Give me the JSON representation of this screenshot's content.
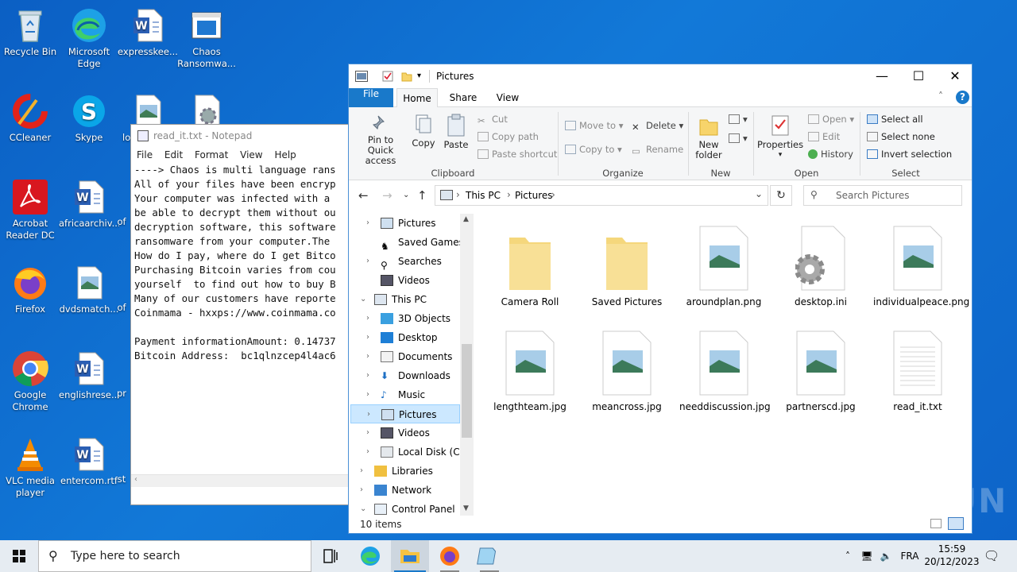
{
  "desktop": {
    "icons": [
      {
        "label": "Recycle Bin"
      },
      {
        "label": "Microsoft Edge"
      },
      {
        "label": "expresskee..."
      },
      {
        "label": "Chaos Ransomwa..."
      },
      {
        "label": "CCleaner"
      },
      {
        "label": "Skype"
      },
      {
        "label": "lo"
      },
      {
        "label": "Acrobat Reader DC"
      },
      {
        "label": "africaarchiv..."
      },
      {
        "label": "of"
      },
      {
        "label": "Firefox"
      },
      {
        "label": "dvdsmatch..."
      },
      {
        "label": "of"
      },
      {
        "label": "Google Chrome"
      },
      {
        "label": "englishrese..."
      },
      {
        "label": "pr"
      },
      {
        "label": "VLC media player"
      },
      {
        "label": "entercom.rtf"
      },
      {
        "label": "st"
      }
    ]
  },
  "notepad": {
    "title": "read_it.txt - Notepad",
    "menu": [
      "File",
      "Edit",
      "Format",
      "View",
      "Help"
    ],
    "text": "----> Chaos is multi language rans\nAll of your files have been encryp\nYour computer was infected with a \nbe able to decrypt them without ou\ndecryption software, this software\nransomware from your computer.The \nHow do I pay, where do I get Bitco\nPurchasing Bitcoin varies from cou\nyourself  to find out how to buy B\nMany of our customers have reporte\nCoinmama - hxxps://www.coinmama.co\n\nPayment informationAmount: 0.14737\nBitcoin Address:  bc1qlnzcep4l4ac6"
  },
  "explorer": {
    "title": "Pictures",
    "tabs": [
      "File",
      "Home",
      "Share",
      "View"
    ],
    "ribbon": {
      "clipboard": {
        "pin": "Pin to Quick access",
        "copy": "Copy",
        "paste": "Paste",
        "cut": "Cut",
        "copy_path": "Copy path",
        "paste_shortcut": "Paste shortcut",
        "label": "Clipboard"
      },
      "organize": {
        "move_to": "Move to",
        "copy_to": "Copy to",
        "delete": "Delete",
        "rename": "Rename",
        "label": "Organize"
      },
      "new": {
        "new_folder": "New folder",
        "label": "New"
      },
      "open": {
        "properties": "Properties",
        "open": "Open",
        "edit": "Edit",
        "history": "History",
        "label": "Open"
      },
      "select": {
        "select_all": "Select all",
        "select_none": "Select none",
        "invert": "Invert selection",
        "label": "Select"
      }
    },
    "address": {
      "crumbs": [
        "This PC",
        "Pictures"
      ],
      "search_placeholder": "Search Pictures"
    },
    "nav": [
      {
        "label": "Pictures"
      },
      {
        "label": "Saved Games"
      },
      {
        "label": "Searches"
      },
      {
        "label": "Videos"
      },
      {
        "label": "This PC"
      },
      {
        "label": "3D Objects"
      },
      {
        "label": "Desktop"
      },
      {
        "label": "Documents"
      },
      {
        "label": "Downloads"
      },
      {
        "label": "Music"
      },
      {
        "label": "Pictures"
      },
      {
        "label": "Videos"
      },
      {
        "label": "Local Disk (C:)"
      },
      {
        "label": "Libraries"
      },
      {
        "label": "Network"
      },
      {
        "label": "Control Panel"
      }
    ],
    "files": [
      {
        "name": "Camera Roll"
      },
      {
        "name": "Saved Pictures"
      },
      {
        "name": "aroundplan.png"
      },
      {
        "name": "desktop.ini"
      },
      {
        "name": "individualpeace.png"
      },
      {
        "name": "lengthteam.jpg"
      },
      {
        "name": "meancross.jpg"
      },
      {
        "name": "needdiscussion.jpg"
      },
      {
        "name": "partnerscd.jpg"
      },
      {
        "name": "read_it.txt"
      }
    ],
    "status": "10 items"
  },
  "taskbar": {
    "search_placeholder": "Type here to search",
    "language": "FRA",
    "time": "15:59",
    "date": "20/12/2023"
  },
  "watermark": "ANY RUN",
  "colors": {
    "desktop": "#0b5fc4",
    "accent": "#1979ca",
    "selection": "#cce8ff"
  }
}
